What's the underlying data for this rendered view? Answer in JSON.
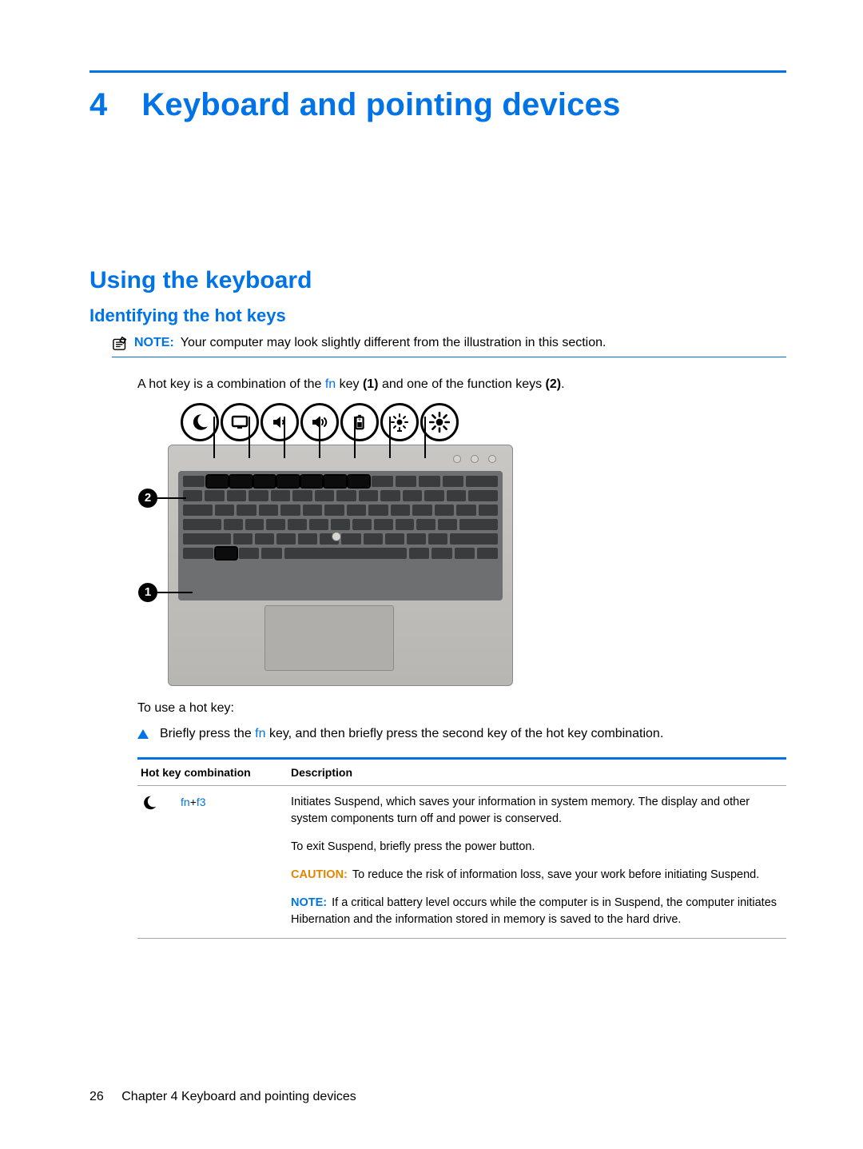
{
  "chapter": {
    "number": "4",
    "title": "Keyboard and pointing devices"
  },
  "section": "Using the keyboard",
  "subsection": "Identifying the hot keys",
  "note": {
    "label": "NOTE:",
    "text": "Your computer may look slightly different from the illustration in this section."
  },
  "intro": {
    "pre": "A hot key is a combination of the ",
    "fn": "fn",
    "mid": " key ",
    "b1": "(1)",
    "mid2": " and one of the function keys ",
    "b2": "(2)",
    "post": "."
  },
  "illustration": {
    "callouts": {
      "1": "1",
      "2": "2"
    },
    "icons": [
      "moon-icon",
      "display-icon",
      "volume-down-icon",
      "volume-up-icon",
      "battery-icon",
      "brightness-down-icon",
      "brightness-up-icon"
    ]
  },
  "to_use": "To use a hot key:",
  "step": {
    "pre": "Briefly press the ",
    "fn": "fn",
    "post": " key, and then briefly press the second key of the hot key combination."
  },
  "table": {
    "headers": {
      "combo": "Hot key combination",
      "desc": "Description"
    },
    "rows": [
      {
        "icon": "moon-icon",
        "combo": {
          "a": "fn",
          "plus": "+",
          "b": "f3"
        },
        "p1": "Initiates Suspend, which saves your information in system memory. The display and other system components turn off and power is conserved.",
        "p2": "To exit Suspend, briefly press the power button.",
        "caution_label": "CAUTION:",
        "caution_text": "To reduce the risk of information loss, save your work before initiating Suspend.",
        "note_label": "NOTE:",
        "note_text": "If a critical battery level occurs while the computer is in Suspend, the computer initiates Hibernation and the information stored in memory is saved to the hard drive."
      }
    ]
  },
  "footer": {
    "page": "26",
    "chapter_label": "Chapter 4   Keyboard and pointing devices"
  }
}
